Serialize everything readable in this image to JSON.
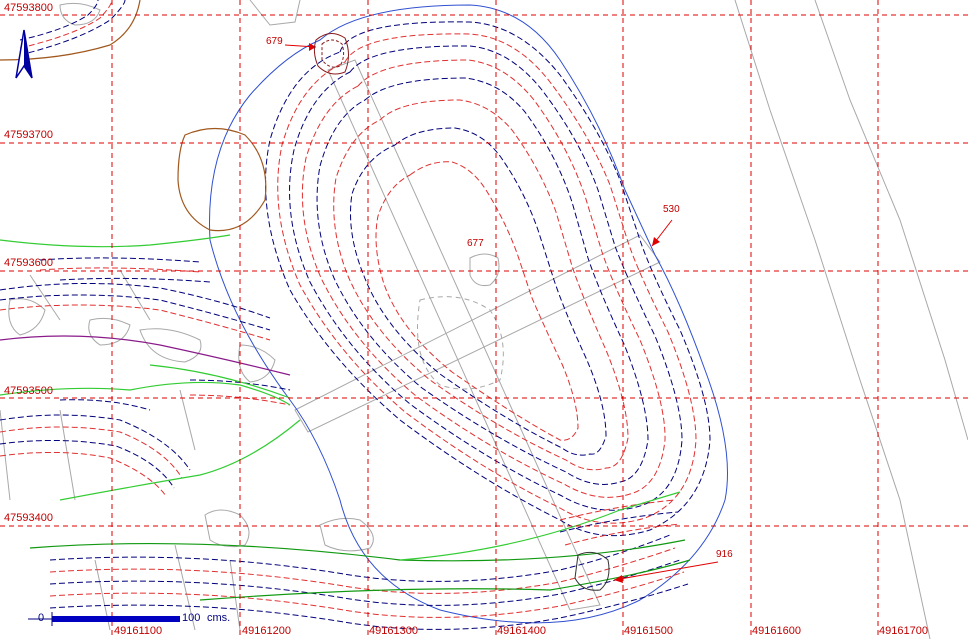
{
  "map": {
    "y_grid_labels": [
      "47593800",
      "47593700",
      "47593600",
      "47593500",
      "47593400"
    ],
    "x_grid_labels": [
      "49161100",
      "49161200",
      "49161300",
      "49161400",
      "49161500",
      "49161600",
      "49161700"
    ],
    "annotations": [
      {
        "id": "679",
        "label": "679"
      },
      {
        "id": "677",
        "label": "677"
      },
      {
        "id": "530",
        "label": "530"
      },
      {
        "id": "916",
        "label": "916"
      }
    ],
    "scale_bar": {
      "start": "0",
      "end": "100",
      "unit": "cms."
    },
    "north_arrow": {
      "icon": "north-arrow-icon"
    },
    "colors": {
      "grid": "#dd0000",
      "contour_blue": "#00007a",
      "contour_red": "#e03030",
      "outline": "#3050d0",
      "green": "#33cc33",
      "dark_green": "#119911",
      "brown": "#a0581e",
      "purple": "#8a1a8a",
      "grey": "#a0a0a0"
    }
  }
}
